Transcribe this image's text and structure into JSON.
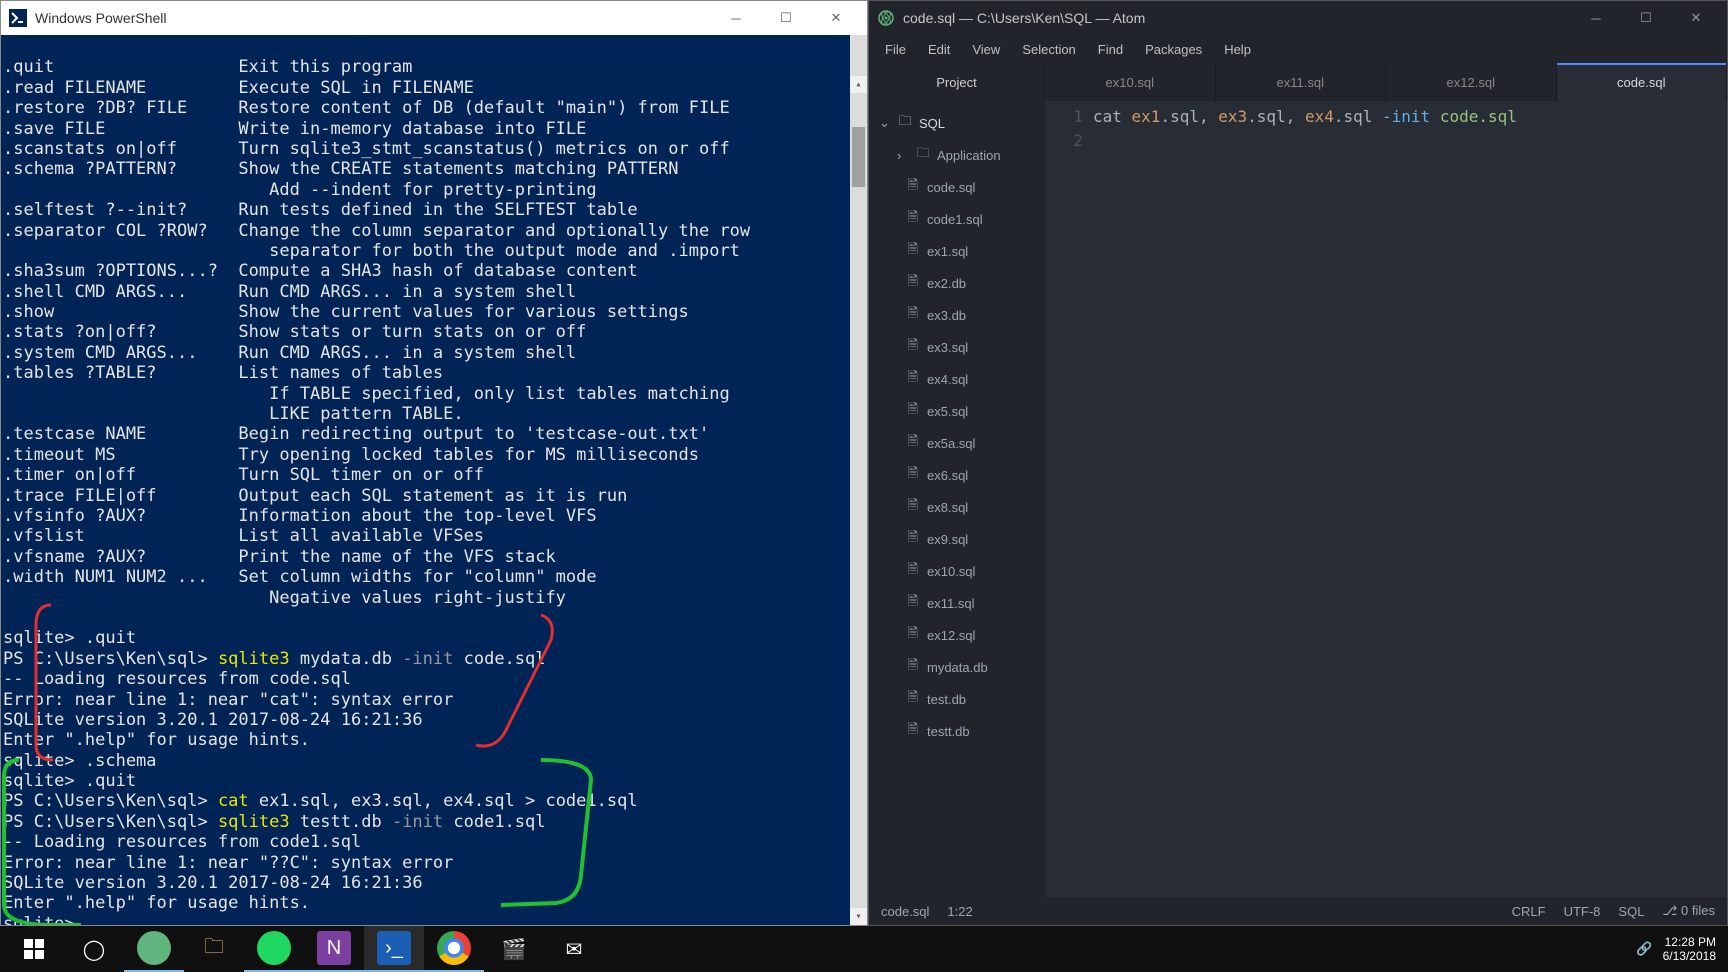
{
  "powershell": {
    "title": "Windows PowerShell",
    "help_lines": [
      ".quit                  Exit this program",
      ".read FILENAME         Execute SQL in FILENAME",
      ".restore ?DB? FILE     Restore content of DB (default \"main\") from FILE",
      ".save FILE             Write in-memory database into FILE",
      ".scanstats on|off      Turn sqlite3_stmt_scanstatus() metrics on or off",
      ".schema ?PATTERN?      Show the CREATE statements matching PATTERN",
      "                          Add --indent for pretty-printing",
      ".selftest ?--init?     Run tests defined in the SELFTEST table",
      ".separator COL ?ROW?   Change the column separator and optionally the row",
      "                          separator for both the output mode and .import",
      ".sha3sum ?OPTIONS...?  Compute a SHA3 hash of database content",
      ".shell CMD ARGS...     Run CMD ARGS... in a system shell",
      ".show                  Show the current values for various settings",
      ".stats ?on|off?        Show stats or turn stats on or off",
      ".system CMD ARGS...    Run CMD ARGS... in a system shell",
      ".tables ?TABLE?        List names of tables",
      "                          If TABLE specified, only list tables matching",
      "                          LIKE pattern TABLE.",
      ".testcase NAME         Begin redirecting output to 'testcase-out.txt'",
      ".timeout MS            Try opening locked tables for MS milliseconds",
      ".timer on|off          Turn SQL timer on or off",
      ".trace FILE|off        Output each SQL statement as it is run",
      ".vfsinfo ?AUX?         Information about the top-level VFS",
      ".vfslist               List all available VFSes",
      ".vfsname ?AUX?         Print the name of the VFS stack",
      ".width NUM1 NUM2 ...   Set column widths for \"column\" mode",
      "                          Negative values right-justify"
    ],
    "session": {
      "l1": "sqlite> .quit",
      "l2_prompt": "PS C:\\Users\\Ken\\sql> ",
      "l2_cmd": "sqlite3",
      "l2_arg": " mydata.db ",
      "l2_flag": "-init",
      "l2_tail": " code.sql",
      "l3": "-- Loading resources from code.sql",
      "l4": "Error: near line 1: near \"cat\": syntax error",
      "l5": "SQLite version 3.20.1 2017-08-24 16:21:36",
      "l6": "Enter \".help\" for usage hints.",
      "l7": "sqlite> .schema",
      "l8": "sqlite> .quit",
      "l9_prompt": "PS C:\\Users\\Ken\\sql> ",
      "l9_cmd": "cat",
      "l9_tail": " ex1.sql, ex3.sql, ex4.sql > code1.sql",
      "l10_prompt": "PS C:\\Users\\Ken\\sql> ",
      "l10_cmd": "sqlite3",
      "l10_arg": " testt.db ",
      "l10_flag": "-init",
      "l10_tail": " code1.sql",
      "l11": "-- Loading resources from code1.sql",
      "l12": "Error: near line 1: near \"??C\": syntax error",
      "l13": "SQLite version 3.20.1 2017-08-24 16:21:36",
      "l14": "Enter \".help\" for usage hints.",
      "l15": "sqlite>"
    }
  },
  "atom": {
    "title": "code.sql — C:\\Users\\Ken\\SQL — Atom",
    "menu": [
      "File",
      "Edit",
      "View",
      "Selection",
      "Find",
      "Packages",
      "Help"
    ],
    "tabs": {
      "project": "Project",
      "files": [
        "ex10.sql",
        "ex11.sql",
        "ex12.sql",
        "code.sql"
      ],
      "active_index": 3
    },
    "tree": {
      "root": "SQL",
      "folder": "Application",
      "files": [
        "code.sql",
        "code1.sql",
        "ex1.sql",
        "ex2.db",
        "ex3.db",
        "ex3.sql",
        "ex4.sql",
        "ex5.sql",
        "ex5a.sql",
        "ex6.sql",
        "ex8.sql",
        "ex9.sql",
        "ex10.sql",
        "ex11.sql",
        "ex12.sql",
        "mydata.db",
        "test.db",
        "testt.db"
      ]
    },
    "editor": {
      "gutter": [
        "1",
        "2"
      ],
      "line1": {
        "a": "cat ",
        "b": "ex1",
        "c": ".sql, ",
        "d": "ex3",
        "e": ".sql, ",
        "f": "ex4",
        "g": ".sql ",
        "h": "-init",
        "i": " code.sql"
      }
    },
    "status": {
      "file": "code.sql",
      "cursor": "1:22",
      "eol": "CRLF",
      "enc": "UTF-8",
      "lang": "SQL",
      "git": "0 files"
    }
  },
  "taskbar": {
    "time": "12:28 PM",
    "date": "6/13/2018"
  }
}
